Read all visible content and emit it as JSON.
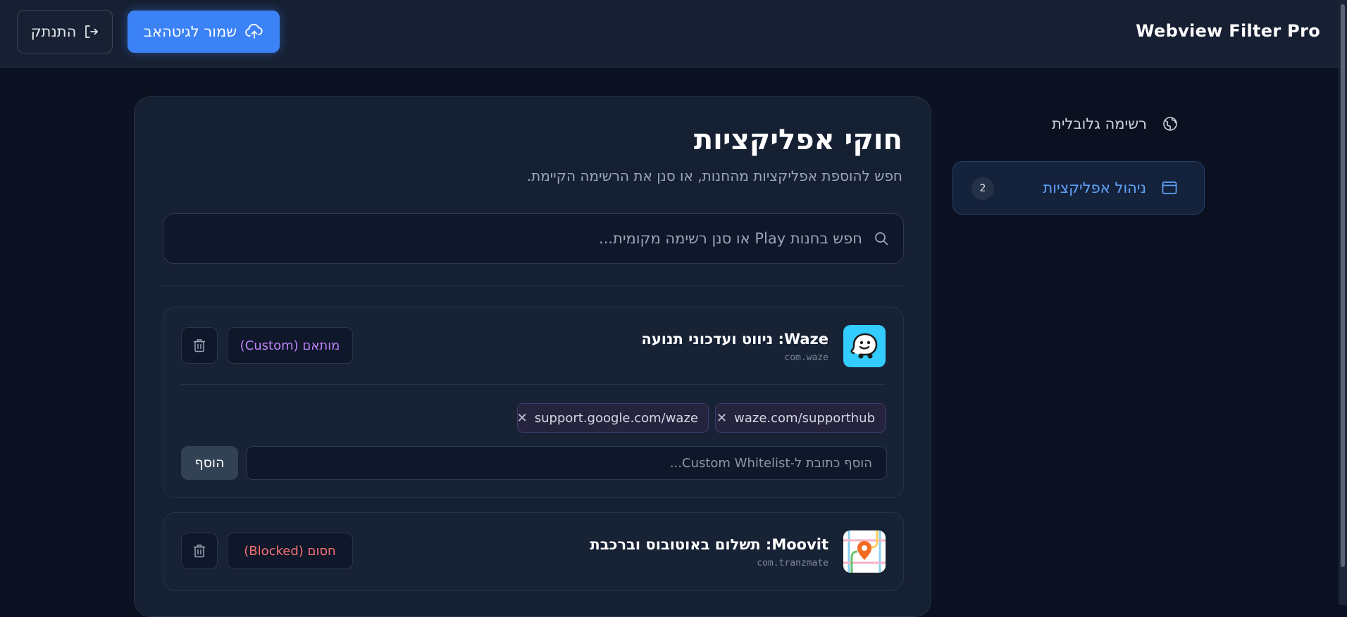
{
  "header": {
    "brand": "Webview Filter Pro",
    "save_label": "שמור לגיטהאב",
    "logout_label": "התנתק"
  },
  "sidebar": {
    "items": [
      {
        "label": "רשימה גלובלית",
        "icon": "globe-icon"
      },
      {
        "label": "ניהול אפליקציות",
        "icon": "window-icon",
        "badge": "2",
        "active": true
      }
    ]
  },
  "main": {
    "title": "חוקי אפליקציות",
    "subtitle": "חפש להוספת אפליקציות מהחנות, או סנן את הרשימה הקיימת.",
    "search_placeholder": "חפש בחנות Play או סנן רשימה מקומית...",
    "apps": [
      {
        "name": "Waze: ניווט ועדכוני תנועה",
        "package": "com.waze",
        "status": "מותאם (Custom)",
        "status_color": "#c084fc",
        "icon": "waze-app-icon",
        "whitelist": [
          "waze.com/supporthub",
          "support.google.com/waze"
        ],
        "add_placeholder": "הוסף כתובת ל-Custom Whitelist...",
        "add_label": "הוסף"
      },
      {
        "name": "Moovit: תשלום באוטובוס וברכבת",
        "package": "com.tranzmate",
        "status": "חסום (Blocked)",
        "status_color": "#f87171",
        "icon": "moovit-app-icon"
      }
    ]
  },
  "colors": {
    "background": "#0b1120",
    "accent": "#3b82f6",
    "active_nav": "#60a5fa"
  }
}
